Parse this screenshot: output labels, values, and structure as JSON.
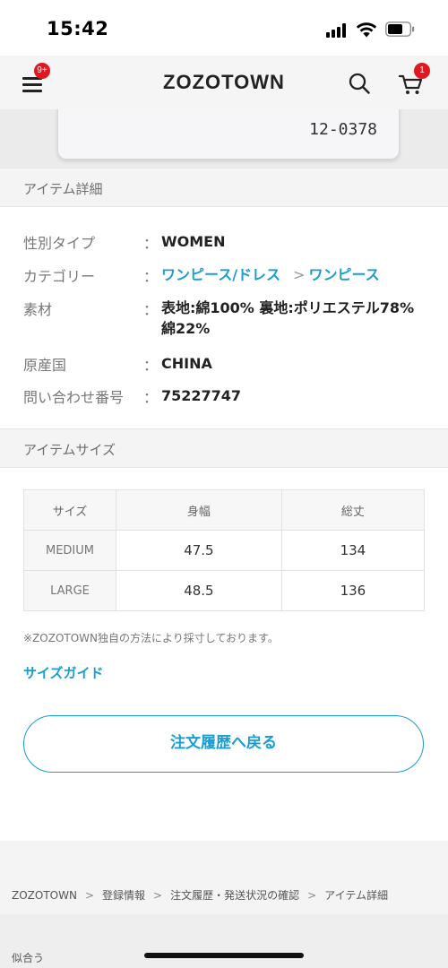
{
  "status_bar": {
    "time": "15:42"
  },
  "header": {
    "menu_badge": "9+",
    "logo": "ZOZOTOWN",
    "cart_badge": "1"
  },
  "product_image": {
    "tag_code": "12-0378"
  },
  "item_details": {
    "section_title": "アイテム詳細",
    "rows": [
      {
        "label": "性別タイプ",
        "colon": "：",
        "value": "WOMEN"
      },
      {
        "label": "カテゴリー",
        "colon": "：",
        "category_main": "ワンピース/ドレス",
        "category_sep": ">",
        "category_sub": "ワンピース"
      },
      {
        "label": "素材",
        "colon": "：",
        "value_line1": "表地:綿100% 裏地:ポリエステル78%",
        "value_line2": "綿22%"
      },
      {
        "label": "原産国",
        "colon": "：",
        "value": "CHINA"
      },
      {
        "label": "問い合わせ番号",
        "colon": "：",
        "value": "75227747"
      }
    ]
  },
  "item_size": {
    "section_title": "アイテムサイズ",
    "headers": [
      "サイズ",
      "身幅",
      "総丈"
    ],
    "rows": [
      [
        "MEDIUM",
        "47.5",
        "134"
      ],
      [
        "LARGE",
        "48.5",
        "136"
      ]
    ],
    "note": "※ZOZOTOWN独自の方法により採寸しております。",
    "size_guide_link": "サイズガイド"
  },
  "back_button": "注文履歴へ戻る",
  "breadcrumb": [
    "ZOZOTOWN",
    "登録情報",
    "注文履歴・発送状況の確認",
    "アイテム詳細"
  ],
  "breadcrumb_separator": ">",
  "bottom_label": "似合う",
  "colors": {
    "accent": "#1a9dd0",
    "badge": "#e0181f"
  }
}
